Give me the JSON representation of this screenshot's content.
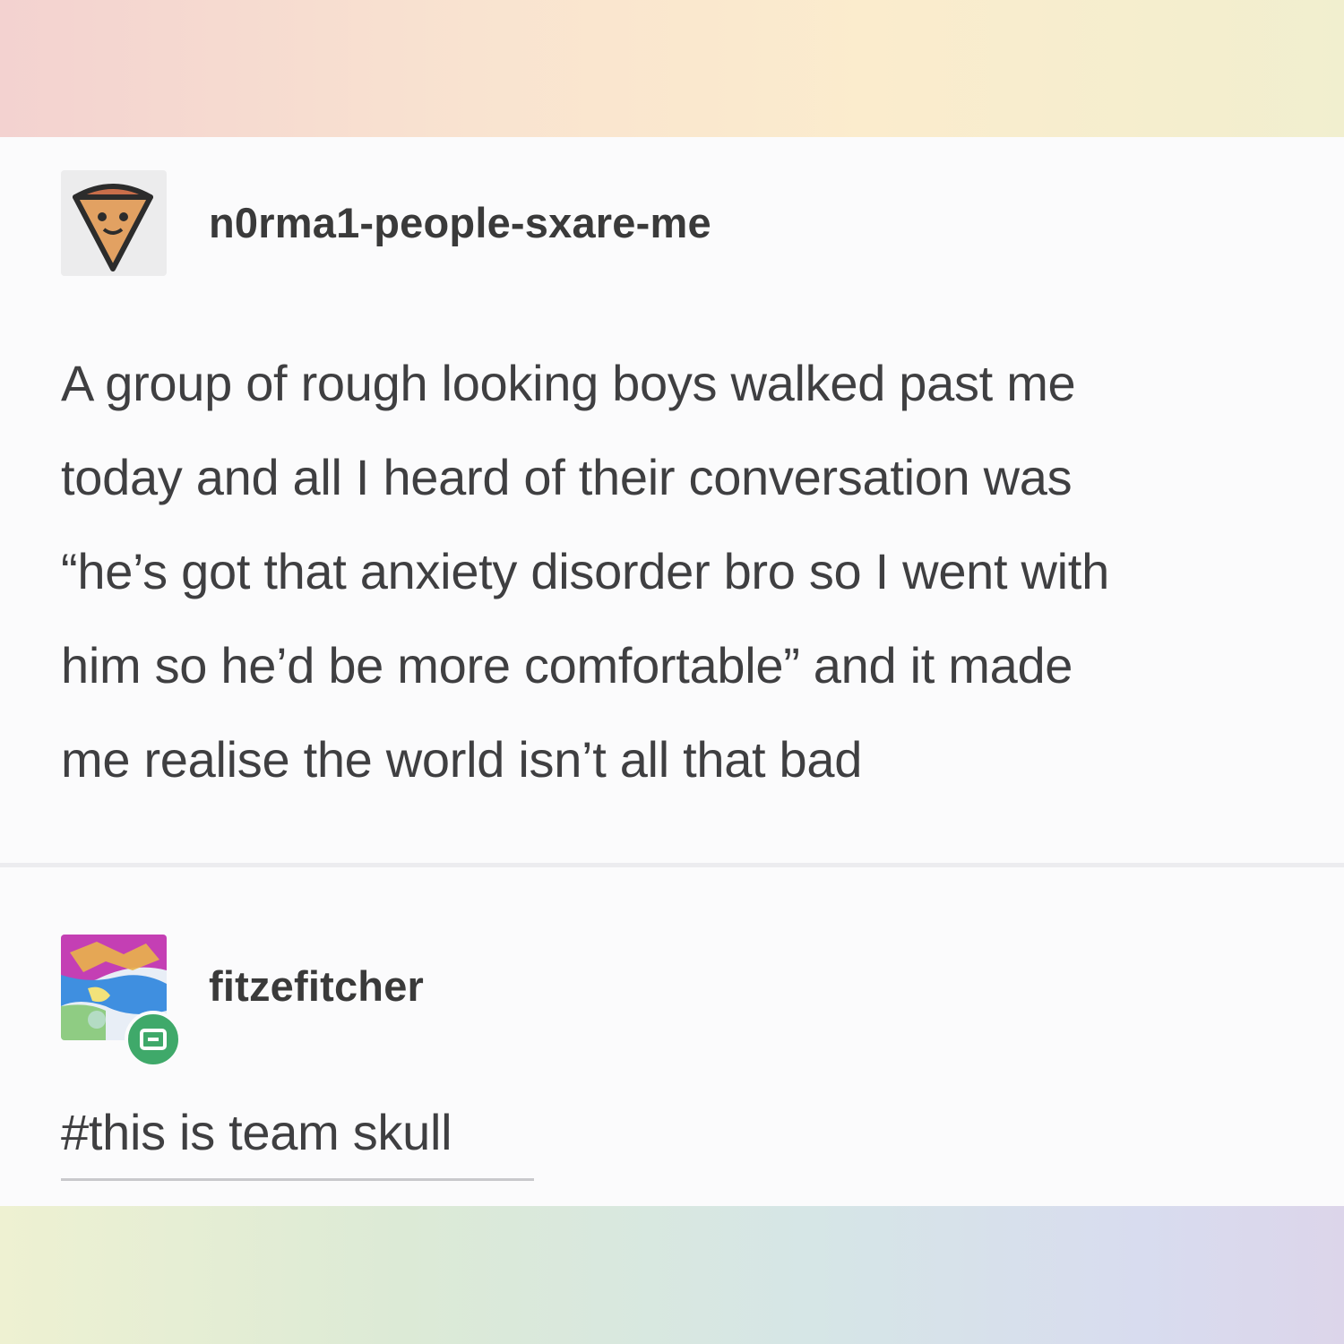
{
  "posts": [
    {
      "username": "n0rma1-people-sxare-me",
      "avatar_icon": "pizza-slice-icon",
      "body_lines": [
        "A group of rough looking boys walked past me",
        "today and all I heard of their conversation was",
        "“he’s got that anxiety disorder bro so I went with",
        "him so he’d be more comfortable” and it made",
        "me realise the world isn’t all that bad"
      ]
    },
    {
      "username": "fitzefitcher",
      "avatar_icon": "colorful-artwork-avatar-icon",
      "badge_icon": "reblog-badge-icon",
      "tag": "#this is team skull"
    }
  ],
  "colors": {
    "card_background": "#fbfbfc",
    "text": "#3f3f41",
    "username_text": "#3a3a3a",
    "badge_green": "#3fa96a"
  }
}
